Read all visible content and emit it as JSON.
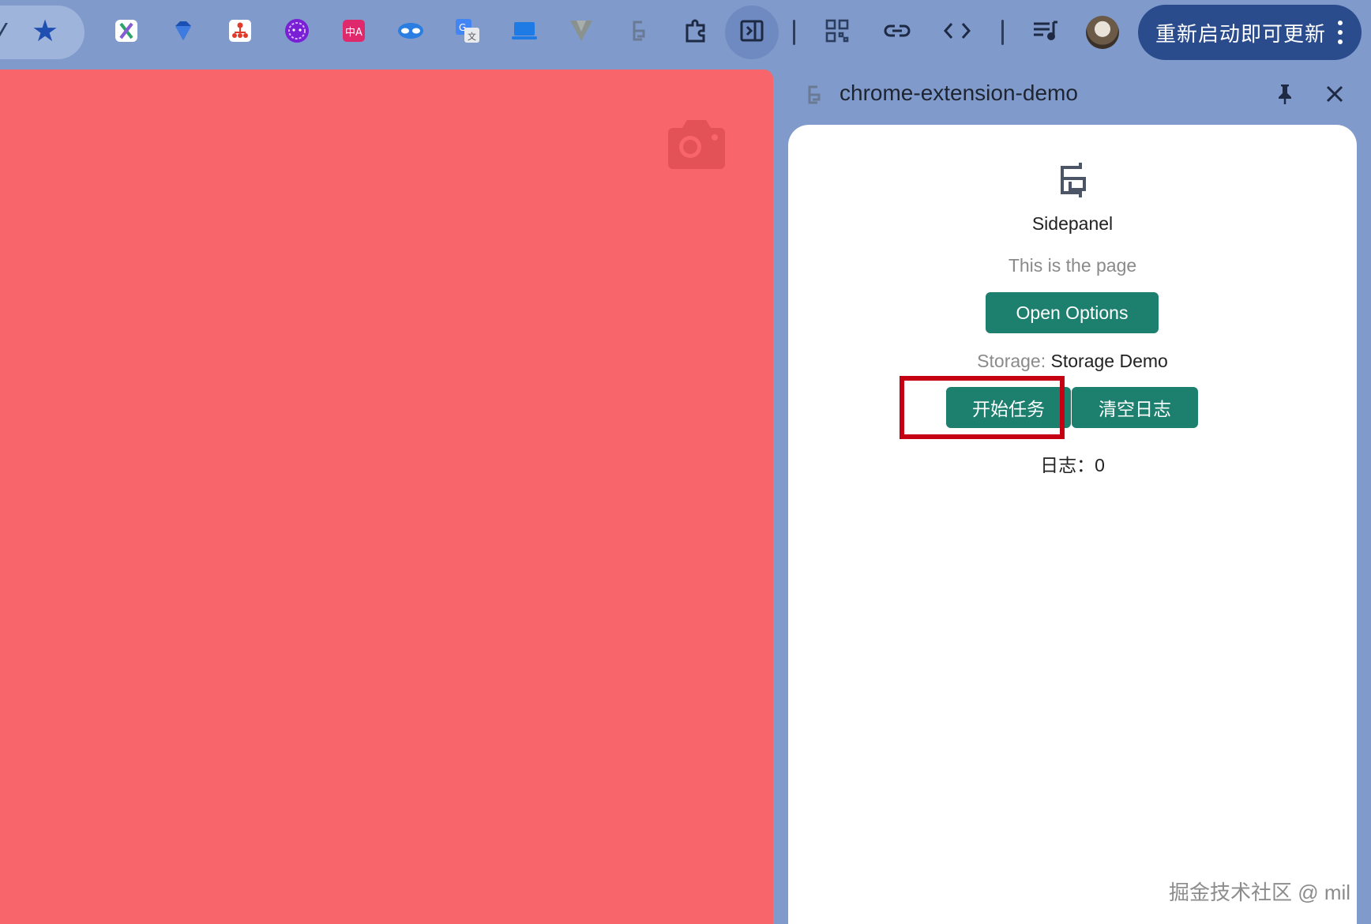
{
  "toolbar": {
    "update_button": {
      "label": "重新启动即可更新"
    },
    "icons": [
      "search-icon",
      "bookmark-star-icon",
      "extension-x-icon",
      "extension-diamond-icon",
      "extension-org-chart-icon",
      "extension-purple-face-icon",
      "extension-translate-a-icon",
      "extension-mask-icon",
      "google-translate-icon",
      "extension-laptop-icon",
      "extension-v-icon",
      "extension-demo-icon",
      "extensions-puzzle-icon",
      "side-panel-toggle-icon",
      "qr-code-icon",
      "link-icon",
      "code-icon",
      "media-queue-icon",
      "profile-avatar"
    ],
    "colors": {
      "background": "#7f9acb",
      "update_button": "#2b4c8c",
      "active_circle": "#6f8ac0"
    }
  },
  "page": {
    "background": "#f8656a",
    "camera_icon": "camera-icon"
  },
  "side_panel": {
    "title": "chrome-extension-demo",
    "content": {
      "heading": "Sidepanel",
      "subtitle": "This is the page",
      "open_options_label": "Open Options",
      "storage_label": "Storage:",
      "storage_value": "Storage Demo",
      "start_task_label": "开始任务",
      "clear_log_label": "清空日志",
      "log_text": "日志：0"
    },
    "colors": {
      "button": "#1d7f6e",
      "highlight": "#c40012"
    }
  },
  "watermark": "掘金技术社区 @ mil"
}
